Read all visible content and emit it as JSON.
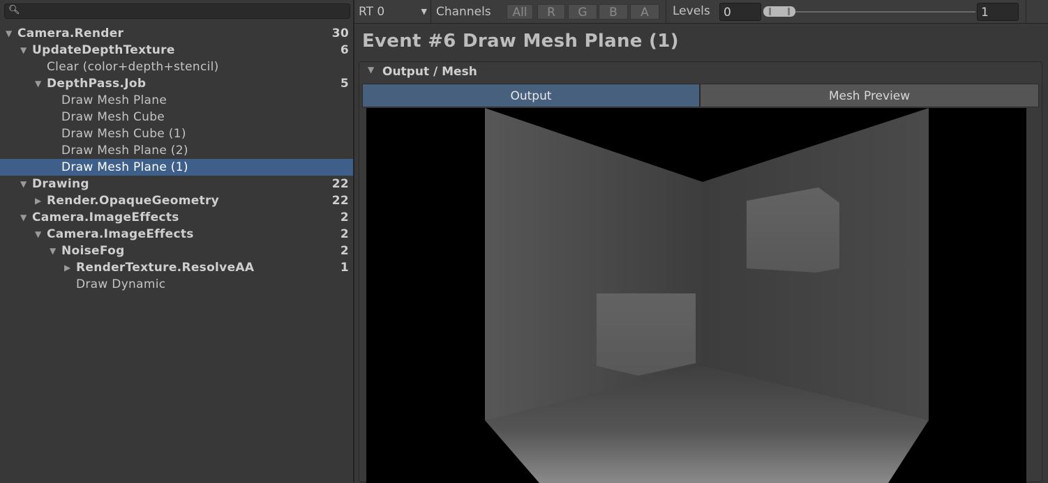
{
  "search": {
    "placeholder": ""
  },
  "tree": [
    {
      "label": "Camera.Render",
      "count": "30",
      "level": 0,
      "expand": "open",
      "bold": true
    },
    {
      "label": "UpdateDepthTexture",
      "count": "6",
      "level": 1,
      "expand": "open",
      "bold": true
    },
    {
      "label": "Clear (color+depth+stencil)",
      "count": "",
      "level": 2,
      "expand": "none",
      "bold": false
    },
    {
      "label": "DepthPass.Job",
      "count": "5",
      "level": 2,
      "expand": "open",
      "bold": true
    },
    {
      "label": "Draw Mesh Plane",
      "count": "",
      "level": 3,
      "expand": "none",
      "bold": false
    },
    {
      "label": "Draw Mesh Cube",
      "count": "",
      "level": 3,
      "expand": "none",
      "bold": false
    },
    {
      "label": "Draw Mesh Cube (1)",
      "count": "",
      "level": 3,
      "expand": "none",
      "bold": false
    },
    {
      "label": "Draw Mesh Plane (2)",
      "count": "",
      "level": 3,
      "expand": "none",
      "bold": false
    },
    {
      "label": "Draw Mesh Plane (1)",
      "count": "",
      "level": 3,
      "expand": "none",
      "bold": false,
      "selected": true
    },
    {
      "label": "Drawing",
      "count": "22",
      "level": 1,
      "expand": "open",
      "bold": true
    },
    {
      "label": "Render.OpaqueGeometry",
      "count": "22",
      "level": 2,
      "expand": "closed",
      "bold": true
    },
    {
      "label": "Camera.ImageEffects",
      "count": "2",
      "level": 1,
      "expand": "open",
      "bold": true
    },
    {
      "label": "Camera.ImageEffects",
      "count": "2",
      "level": 2,
      "expand": "open",
      "bold": true
    },
    {
      "label": "NoiseFog",
      "count": "2",
      "level": 3,
      "expand": "open",
      "bold": true
    },
    {
      "label": "RenderTexture.ResolveAA",
      "count": "1",
      "level": 4,
      "expand": "closed",
      "bold": true
    },
    {
      "label": "Draw Dynamic",
      "count": "",
      "level": 4,
      "expand": "none",
      "bold": false
    }
  ],
  "toolbar": {
    "rt_label": "RT 0",
    "channels_label": "Channels",
    "channels": [
      "All",
      "R",
      "G",
      "B",
      "A"
    ],
    "levels_label": "Levels",
    "levels_min": "0",
    "levels_max": "1"
  },
  "event_title": "Event #6 Draw Mesh Plane (1)",
  "section": {
    "title": "Output / Mesh",
    "tabs": [
      "Output",
      "Mesh Preview"
    ],
    "active_tab": "Output"
  },
  "icons": {
    "search": "search-icon",
    "dropdown": "chevron-down-icon",
    "expanded": "triangle-down-icon",
    "collapsed": "triangle-right-icon"
  },
  "colors": {
    "selection": "#3e5f8a",
    "active_tab": "#46607e",
    "panel": "#383838"
  }
}
